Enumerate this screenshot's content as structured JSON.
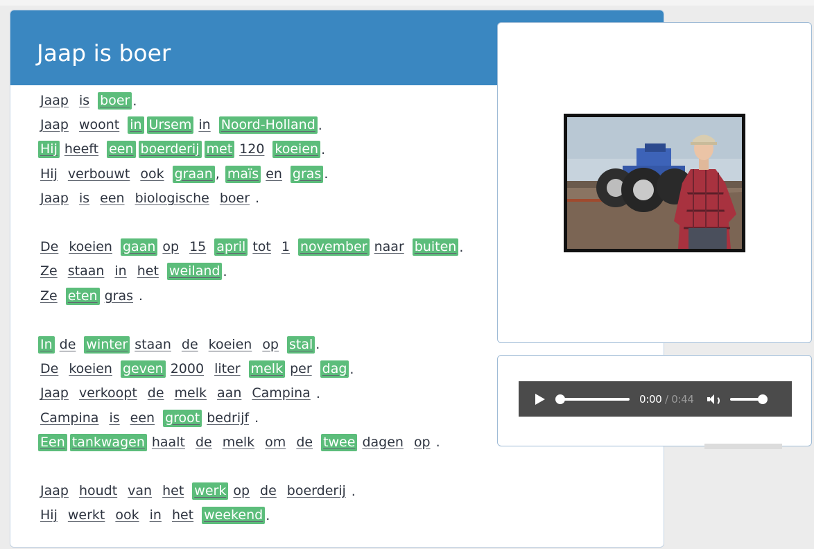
{
  "lesson": {
    "title": "Jaap is boer",
    "lines": [
      [
        {
          "t": "Jaap"
        },
        {
          "t": "is"
        },
        {
          "t": "boer",
          "h": true
        },
        {
          "p": "."
        }
      ],
      [
        {
          "t": "Jaap"
        },
        {
          "t": "woont"
        },
        {
          "t": "in",
          "h": true
        },
        {
          "t": "Ursem",
          "h": true
        },
        {
          "t": "in"
        },
        {
          "t": "Noord-Holland",
          "h": true
        },
        {
          "p": "."
        }
      ],
      [
        {
          "t": "Hij",
          "h": true
        },
        {
          "t": "heeft"
        },
        {
          "t": "een",
          "h": true
        },
        {
          "t": "boerderij",
          "h": true
        },
        {
          "t": "met",
          "h": true
        },
        {
          "t": "120"
        },
        {
          "t": "koeien",
          "h": true
        },
        {
          "p": "."
        }
      ],
      [
        {
          "t": "Hij"
        },
        {
          "t": "verbouwt"
        },
        {
          "t": "ook"
        },
        {
          "t": "graan",
          "h": true
        },
        {
          "p": ","
        },
        {
          "t": "maïs",
          "h": true
        },
        {
          "t": "en"
        },
        {
          "t": "gras",
          "h": true
        },
        {
          "p": "."
        }
      ],
      [
        {
          "t": "Jaap"
        },
        {
          "t": "is"
        },
        {
          "t": "een"
        },
        {
          "t": "biologische"
        },
        {
          "t": "boer"
        },
        {
          "p": "."
        }
      ],
      [],
      [
        {
          "t": "De"
        },
        {
          "t": "koeien"
        },
        {
          "t": "gaan",
          "h": true
        },
        {
          "t": "op"
        },
        {
          "t": "15"
        },
        {
          "t": "april",
          "h": true
        },
        {
          "t": "tot"
        },
        {
          "t": "1"
        },
        {
          "t": "november",
          "h": true
        },
        {
          "t": "naar"
        },
        {
          "t": "buiten",
          "h": true
        },
        {
          "p": "."
        }
      ],
      [
        {
          "t": "Ze"
        },
        {
          "t": "staan"
        },
        {
          "t": "in"
        },
        {
          "t": "het"
        },
        {
          "t": "weiland",
          "h": true
        },
        {
          "p": "."
        }
      ],
      [
        {
          "t": "Ze"
        },
        {
          "t": "eten",
          "h": true
        },
        {
          "t": "gras"
        },
        {
          "p": "."
        }
      ],
      [],
      [
        {
          "t": "In",
          "h": true
        },
        {
          "t": "de"
        },
        {
          "t": "winter",
          "h": true
        },
        {
          "t": "staan"
        },
        {
          "t": "de"
        },
        {
          "t": "koeien"
        },
        {
          "t": "op"
        },
        {
          "t": "stal",
          "h": true
        },
        {
          "p": "."
        }
      ],
      [
        {
          "t": "De"
        },
        {
          "t": "koeien"
        },
        {
          "t": "geven",
          "h": true
        },
        {
          "t": "2000"
        },
        {
          "t": "liter"
        },
        {
          "t": "melk",
          "h": true
        },
        {
          "t": "per"
        },
        {
          "t": "dag",
          "h": true
        },
        {
          "p": "."
        }
      ],
      [
        {
          "t": "Jaap"
        },
        {
          "t": "verkoopt"
        },
        {
          "t": "de"
        },
        {
          "t": "melk"
        },
        {
          "t": "aan"
        },
        {
          "t": "Campina"
        },
        {
          "p": "."
        }
      ],
      [
        {
          "t": "Campina"
        },
        {
          "t": "is"
        },
        {
          "t": "een"
        },
        {
          "t": "groot",
          "h": true
        },
        {
          "t": "bedrijf"
        },
        {
          "p": "."
        }
      ],
      [
        {
          "t": "Een",
          "h": true
        },
        {
          "t": "tankwagen",
          "h": true
        },
        {
          "t": "haalt"
        },
        {
          "t": "de"
        },
        {
          "t": "melk"
        },
        {
          "t": "om"
        },
        {
          "t": "de"
        },
        {
          "t": "twee",
          "h": true
        },
        {
          "t": "dagen"
        },
        {
          "t": "op"
        },
        {
          "p": "."
        }
      ],
      [],
      [
        {
          "t": "Jaap"
        },
        {
          "t": "houdt"
        },
        {
          "t": "van"
        },
        {
          "t": "het"
        },
        {
          "t": "werk",
          "h": true
        },
        {
          "t": "op"
        },
        {
          "t": "de"
        },
        {
          "t": "boerderij"
        },
        {
          "p": "."
        }
      ],
      [
        {
          "t": "Hij"
        },
        {
          "t": "werkt"
        },
        {
          "t": "ook"
        },
        {
          "t": "in"
        },
        {
          "t": "het"
        },
        {
          "t": "weekend",
          "h": true
        },
        {
          "p": "."
        }
      ]
    ]
  },
  "audio": {
    "current_time": "0:00",
    "separator": "/",
    "duration": "0:44",
    "progress": 0,
    "volume": 1
  },
  "colors": {
    "header": "#3a87c1",
    "highlight": "#5cbd7b",
    "player": "#4b4b4b"
  },
  "icons": {
    "play": "play-icon",
    "volume": "volume-icon"
  }
}
